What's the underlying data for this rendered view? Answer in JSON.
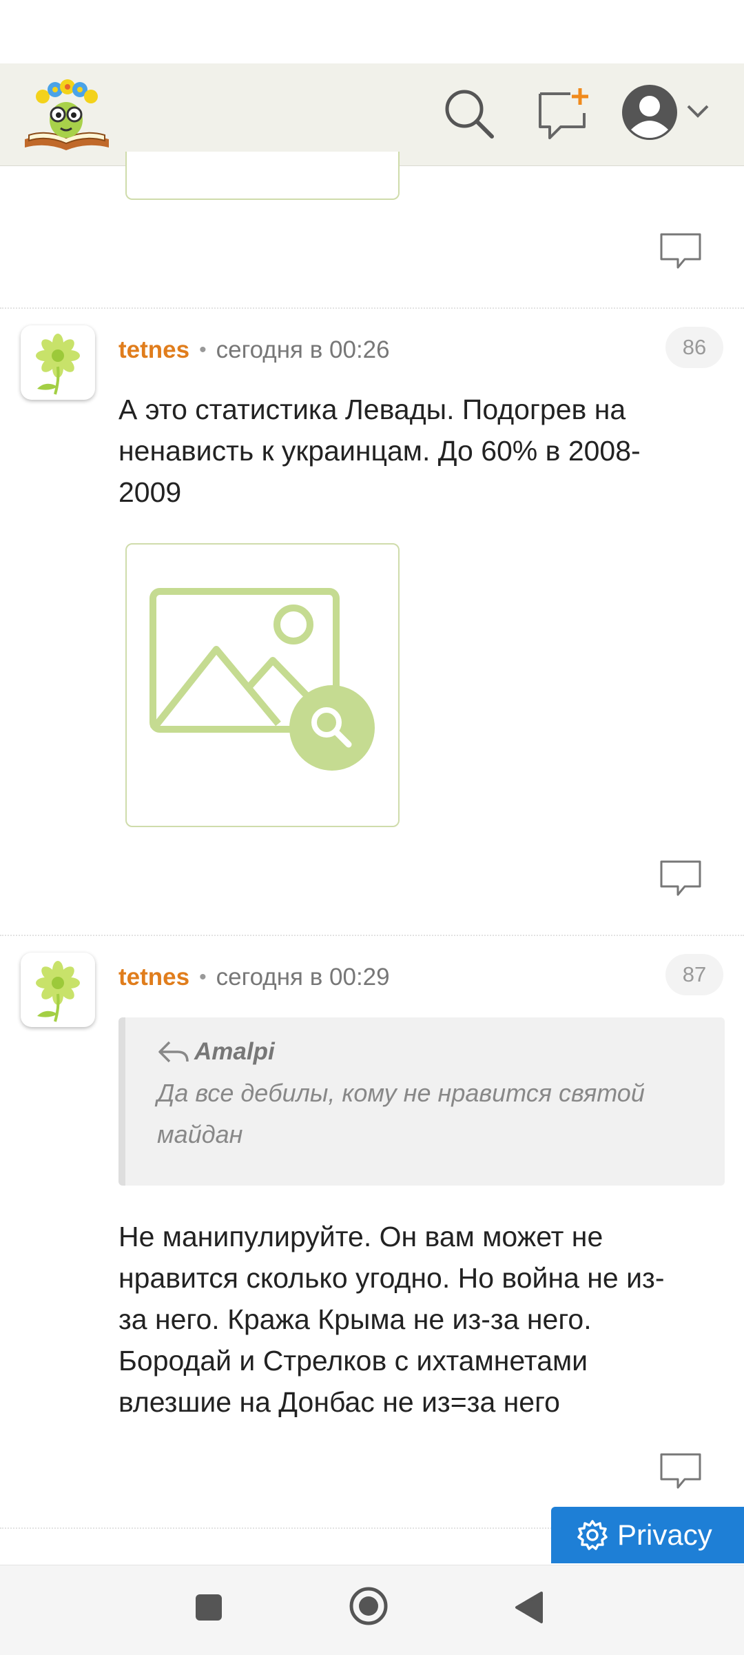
{
  "header": {
    "logo_icon": "bookworm-logo",
    "search_icon": "search-icon",
    "new_message_icon": "new-message-icon",
    "account_icon": "user-avatar-icon",
    "menu_icon": "chevron-down-icon"
  },
  "comments": [
    {
      "author": "tetnes",
      "separator": "•",
      "time": "сегодня в 00:26",
      "number": "86",
      "text_lines": [
        "А это статистика Левады. Подогрев на",
        "ненависть к украинцам. До 60% в 2008-",
        "2009"
      ],
      "has_image": true
    },
    {
      "author": "tetnes",
      "separator": "•",
      "time": "сегодня в 00:29",
      "number": "87",
      "quote": {
        "author": "Amalpi",
        "text_lines": [
          "Да все дебилы, кому не нравится святой",
          "майдан"
        ]
      },
      "text_lines": [
        "Не манипулируйте. Он вам может не",
        "нравится сколько угодно. Но война не из-",
        "за него. Кража Крыма не из-за него.",
        "Бородай и Стрелков с ихтамнетами",
        "влезшие на Донбас не из=за него"
      ]
    }
  ],
  "privacy_button": {
    "label": "Privacy",
    "icon": "gear-icon"
  },
  "colors": {
    "accent": "#e07d1c",
    "privacy": "#1e7fd6",
    "placeholder": "#c5db91"
  }
}
